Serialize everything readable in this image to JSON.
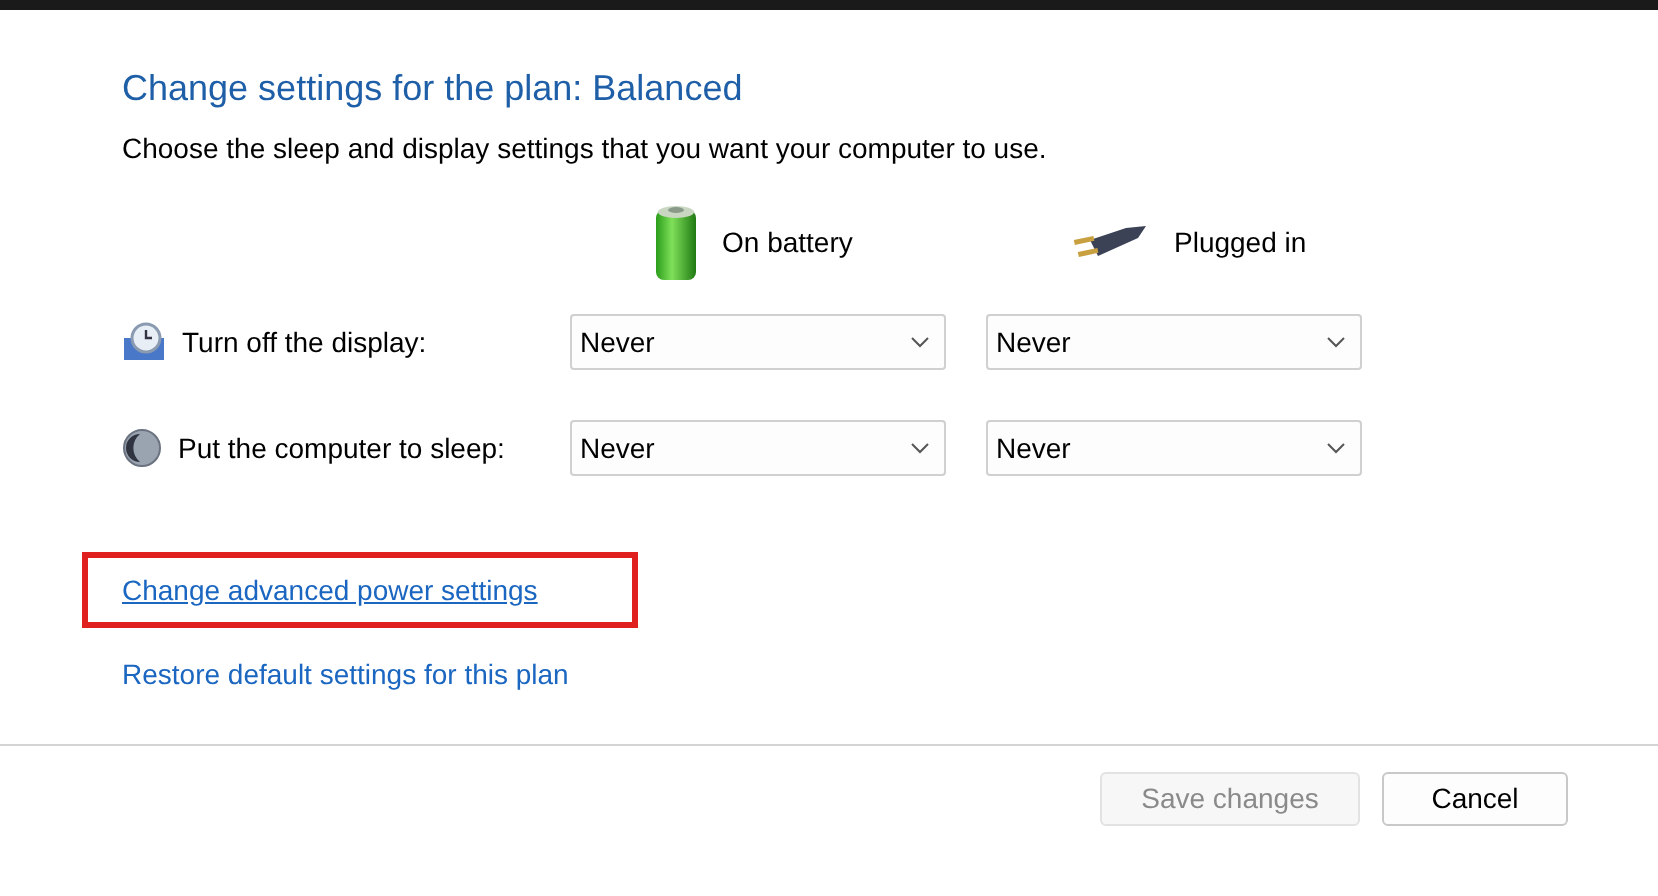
{
  "title": "Change settings for the plan: Balanced",
  "subtitle": "Choose the sleep and display settings that you want your computer to use.",
  "columns": [
    {
      "kind": "battery",
      "label": "On battery"
    },
    {
      "kind": "plug",
      "label": "Plugged in"
    }
  ],
  "settings": [
    {
      "kind": "display",
      "label": "Turn off the display:",
      "values": [
        "Never",
        "Never"
      ]
    },
    {
      "kind": "sleep",
      "label": "Put the computer to sleep:",
      "values": [
        "Never",
        "Never"
      ]
    }
  ],
  "links": [
    {
      "label": "Change advanced power settings",
      "highlighted": true
    },
    {
      "label": "Restore default settings for this plan",
      "highlighted": false
    }
  ],
  "buttons": [
    {
      "label": "Save changes",
      "disabled": true
    },
    {
      "label": "Cancel",
      "disabled": false
    }
  ]
}
